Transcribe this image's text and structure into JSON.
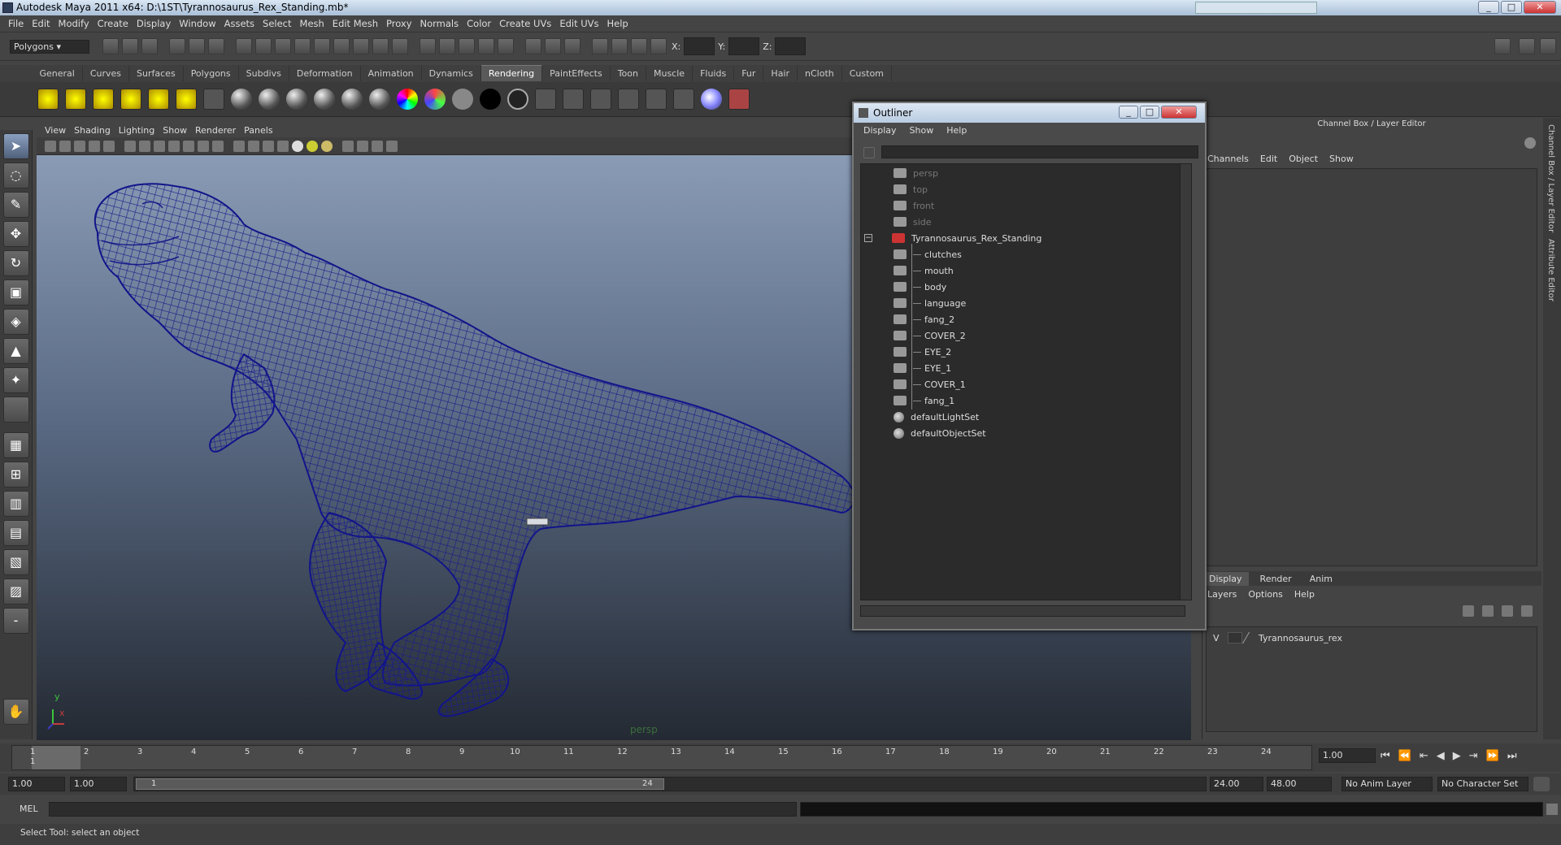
{
  "window": {
    "title": "Autodesk Maya 2011 x64: D:\\1ST\\Tyrannosaurus_Rex_Standing.mb*"
  },
  "menubar": [
    "File",
    "Edit",
    "Modify",
    "Create",
    "Display",
    "Window",
    "Assets",
    "Select",
    "Mesh",
    "Edit Mesh",
    "Proxy",
    "Normals",
    "Color",
    "Create UVs",
    "Edit UVs",
    "Help"
  ],
  "status": {
    "mode": "Polygons",
    "x_label": "X:",
    "y_label": "Y:",
    "z_label": "Z:"
  },
  "shelf_tabs": [
    "General",
    "Curves",
    "Surfaces",
    "Polygons",
    "Subdivs",
    "Deformation",
    "Animation",
    "Dynamics",
    "Rendering",
    "PaintEffects",
    "Toon",
    "Muscle",
    "Fluids",
    "Fur",
    "Hair",
    "nCloth",
    "Custom"
  ],
  "active_shelf": "Rendering",
  "panel_menu": [
    "View",
    "Shading",
    "Lighting",
    "Show",
    "Renderer",
    "Panels"
  ],
  "viewport": {
    "camera": "persp",
    "axis_y": "y",
    "axis_x": "x"
  },
  "outliner": {
    "title": "Outliner",
    "menu": [
      "Display",
      "Show",
      "Help"
    ],
    "cameras": [
      "persp",
      "top",
      "front",
      "side"
    ],
    "group": "Tyrannosaurus_Rex_Standing",
    "children": [
      "clutches",
      "mouth",
      "body",
      "language",
      "fang_2",
      "COVER_2",
      "EYE_2",
      "EYE_1",
      "COVER_1",
      "fang_1"
    ],
    "sets": [
      "defaultLightSet",
      "defaultObjectSet"
    ]
  },
  "channel_box": {
    "title": "Channel Box / Layer Editor",
    "menu": [
      "Channels",
      "Edit",
      "Object",
      "Show"
    ]
  },
  "layer_editor": {
    "tabs": [
      "Display",
      "Render",
      "Anim"
    ],
    "menu": [
      "Layers",
      "Options",
      "Help"
    ],
    "layer_v": "V",
    "layer_name": "Tyrannosaurus_rex"
  },
  "side_tabs": [
    "Channel Box / Layer Editor",
    "Attribute Editor"
  ],
  "timeline": {
    "ticks": [
      "1",
      "2",
      "3",
      "4",
      "5",
      "6",
      "7",
      "8",
      "9",
      "10",
      "11",
      "12",
      "13",
      "14",
      "15",
      "16",
      "17",
      "18",
      "19",
      "20",
      "21",
      "22",
      "23",
      "24"
    ],
    "current_frame": "1",
    "current_field": "1.00"
  },
  "range": {
    "start": "1.00",
    "start2": "1.00",
    "slider_start": "1",
    "slider_end": "24",
    "end": "24.00",
    "end2": "48.00",
    "anim_layer": "No Anim Layer",
    "char_set": "No Character Set"
  },
  "cmd": {
    "label": "MEL"
  },
  "help": {
    "text": "Select Tool: select an object"
  }
}
